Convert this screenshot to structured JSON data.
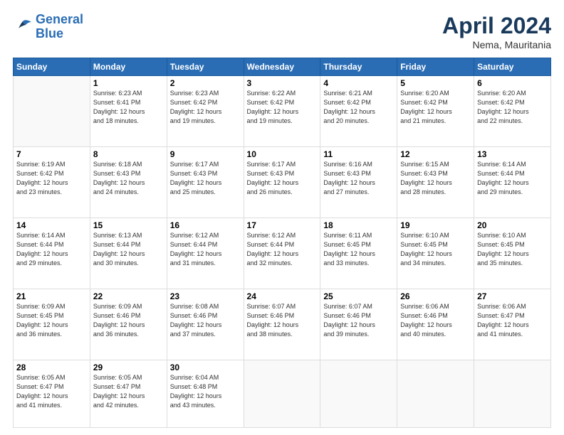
{
  "logo": {
    "line1": "General",
    "line2": "Blue"
  },
  "header": {
    "month": "April 2024",
    "location": "Nema, Mauritania"
  },
  "weekdays": [
    "Sunday",
    "Monday",
    "Tuesday",
    "Wednesday",
    "Thursday",
    "Friday",
    "Saturday"
  ],
  "weeks": [
    [
      {
        "day": "",
        "info": ""
      },
      {
        "day": "1",
        "info": "Sunrise: 6:23 AM\nSunset: 6:41 PM\nDaylight: 12 hours\nand 18 minutes."
      },
      {
        "day": "2",
        "info": "Sunrise: 6:23 AM\nSunset: 6:42 PM\nDaylight: 12 hours\nand 19 minutes."
      },
      {
        "day": "3",
        "info": "Sunrise: 6:22 AM\nSunset: 6:42 PM\nDaylight: 12 hours\nand 19 minutes."
      },
      {
        "day": "4",
        "info": "Sunrise: 6:21 AM\nSunset: 6:42 PM\nDaylight: 12 hours\nand 20 minutes."
      },
      {
        "day": "5",
        "info": "Sunrise: 6:20 AM\nSunset: 6:42 PM\nDaylight: 12 hours\nand 21 minutes."
      },
      {
        "day": "6",
        "info": "Sunrise: 6:20 AM\nSunset: 6:42 PM\nDaylight: 12 hours\nand 22 minutes."
      }
    ],
    [
      {
        "day": "7",
        "info": "Sunrise: 6:19 AM\nSunset: 6:42 PM\nDaylight: 12 hours\nand 23 minutes."
      },
      {
        "day": "8",
        "info": "Sunrise: 6:18 AM\nSunset: 6:43 PM\nDaylight: 12 hours\nand 24 minutes."
      },
      {
        "day": "9",
        "info": "Sunrise: 6:17 AM\nSunset: 6:43 PM\nDaylight: 12 hours\nand 25 minutes."
      },
      {
        "day": "10",
        "info": "Sunrise: 6:17 AM\nSunset: 6:43 PM\nDaylight: 12 hours\nand 26 minutes."
      },
      {
        "day": "11",
        "info": "Sunrise: 6:16 AM\nSunset: 6:43 PM\nDaylight: 12 hours\nand 27 minutes."
      },
      {
        "day": "12",
        "info": "Sunrise: 6:15 AM\nSunset: 6:43 PM\nDaylight: 12 hours\nand 28 minutes."
      },
      {
        "day": "13",
        "info": "Sunrise: 6:14 AM\nSunset: 6:44 PM\nDaylight: 12 hours\nand 29 minutes."
      }
    ],
    [
      {
        "day": "14",
        "info": "Sunrise: 6:14 AM\nSunset: 6:44 PM\nDaylight: 12 hours\nand 29 minutes."
      },
      {
        "day": "15",
        "info": "Sunrise: 6:13 AM\nSunset: 6:44 PM\nDaylight: 12 hours\nand 30 minutes."
      },
      {
        "day": "16",
        "info": "Sunrise: 6:12 AM\nSunset: 6:44 PM\nDaylight: 12 hours\nand 31 minutes."
      },
      {
        "day": "17",
        "info": "Sunrise: 6:12 AM\nSunset: 6:44 PM\nDaylight: 12 hours\nand 32 minutes."
      },
      {
        "day": "18",
        "info": "Sunrise: 6:11 AM\nSunset: 6:45 PM\nDaylight: 12 hours\nand 33 minutes."
      },
      {
        "day": "19",
        "info": "Sunrise: 6:10 AM\nSunset: 6:45 PM\nDaylight: 12 hours\nand 34 minutes."
      },
      {
        "day": "20",
        "info": "Sunrise: 6:10 AM\nSunset: 6:45 PM\nDaylight: 12 hours\nand 35 minutes."
      }
    ],
    [
      {
        "day": "21",
        "info": "Sunrise: 6:09 AM\nSunset: 6:45 PM\nDaylight: 12 hours\nand 36 minutes."
      },
      {
        "day": "22",
        "info": "Sunrise: 6:09 AM\nSunset: 6:46 PM\nDaylight: 12 hours\nand 36 minutes."
      },
      {
        "day": "23",
        "info": "Sunrise: 6:08 AM\nSunset: 6:46 PM\nDaylight: 12 hours\nand 37 minutes."
      },
      {
        "day": "24",
        "info": "Sunrise: 6:07 AM\nSunset: 6:46 PM\nDaylight: 12 hours\nand 38 minutes."
      },
      {
        "day": "25",
        "info": "Sunrise: 6:07 AM\nSunset: 6:46 PM\nDaylight: 12 hours\nand 39 minutes."
      },
      {
        "day": "26",
        "info": "Sunrise: 6:06 AM\nSunset: 6:46 PM\nDaylight: 12 hours\nand 40 minutes."
      },
      {
        "day": "27",
        "info": "Sunrise: 6:06 AM\nSunset: 6:47 PM\nDaylight: 12 hours\nand 41 minutes."
      }
    ],
    [
      {
        "day": "28",
        "info": "Sunrise: 6:05 AM\nSunset: 6:47 PM\nDaylight: 12 hours\nand 41 minutes."
      },
      {
        "day": "29",
        "info": "Sunrise: 6:05 AM\nSunset: 6:47 PM\nDaylight: 12 hours\nand 42 minutes."
      },
      {
        "day": "30",
        "info": "Sunrise: 6:04 AM\nSunset: 6:48 PM\nDaylight: 12 hours\nand 43 minutes."
      },
      {
        "day": "",
        "info": ""
      },
      {
        "day": "",
        "info": ""
      },
      {
        "day": "",
        "info": ""
      },
      {
        "day": "",
        "info": ""
      }
    ]
  ]
}
